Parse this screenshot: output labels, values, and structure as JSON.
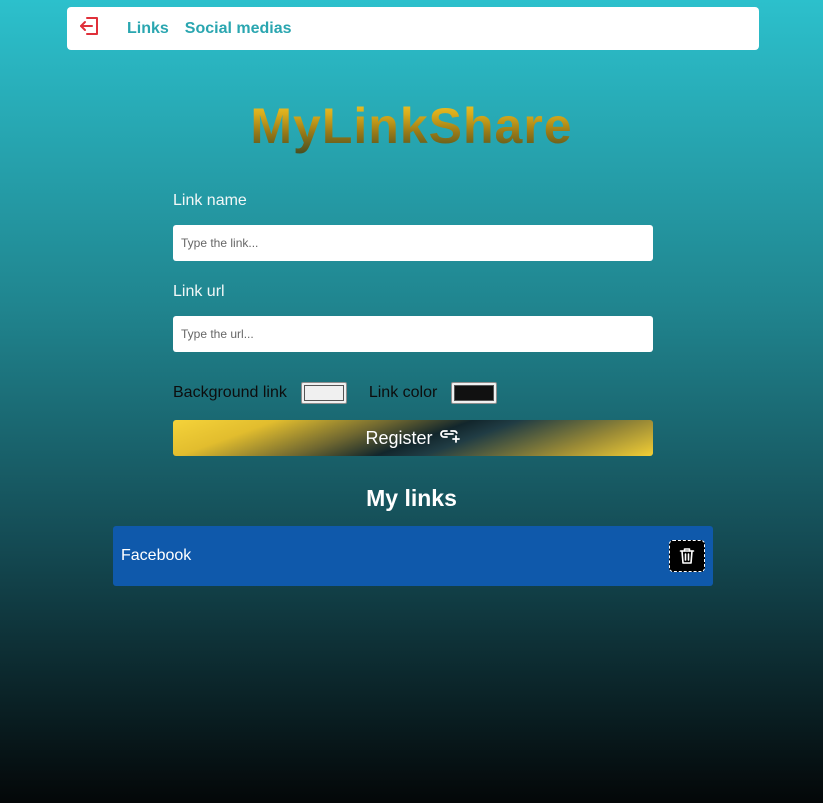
{
  "nav": {
    "logout_icon": "logout-icon",
    "links_label": "Links",
    "social_label": "Social medias",
    "accent_color": "#2aa6b0",
    "logout_color": "#e0303a"
  },
  "brand": {
    "title": "MyLinkShare"
  },
  "form": {
    "link_name_label": "Link name",
    "link_name_placeholder": "Type the link...",
    "link_name_value": "",
    "link_url_label": "Link url",
    "link_url_placeholder": "Type the url...",
    "link_url_value": "",
    "background_label": "Background link",
    "background_value": "#f0f0f0",
    "link_color_label": "Link color",
    "link_color_value": "#111111",
    "register_label": "Register",
    "register_icon": "link-add-icon"
  },
  "links_section": {
    "title": "My links",
    "items": [
      {
        "name": "Facebook",
        "background": "#0f59ab",
        "text_color": "#ffffff",
        "delete_icon": "trash-icon"
      }
    ]
  }
}
